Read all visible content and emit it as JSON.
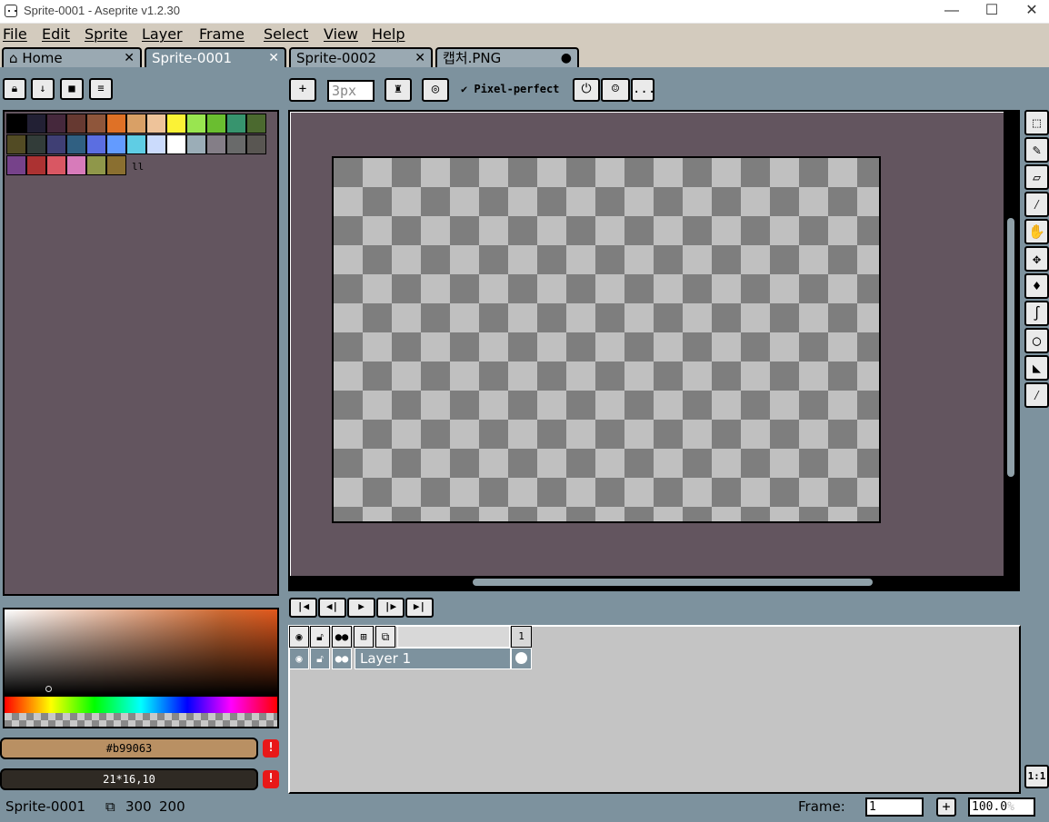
{
  "window": {
    "title": "Sprite-0001 - Aseprite v1.2.30",
    "controls": {
      "minimize": "—",
      "maximize": "☐",
      "close": "✕"
    }
  },
  "menu": [
    "File",
    "Edit",
    "Sprite",
    "Layer",
    "Frame",
    "Select",
    "View",
    "Help"
  ],
  "tabs": [
    {
      "label": "Home",
      "icon": "home-icon",
      "close": "✕"
    },
    {
      "label": "Sprite-0001",
      "close": "✕",
      "active": true
    },
    {
      "label": "Sprite-0002",
      "close": "✕"
    },
    {
      "label": "캡처.PNG",
      "modified": "●"
    }
  ],
  "palette_toolbar": {
    "icons": [
      "lock-icon",
      "sort-icon",
      "palette-icon",
      "menu-icon"
    ],
    "extra_mark": "ll"
  },
  "palette_colors": [
    "#000000",
    "#222034",
    "#45283c",
    "#663931",
    "#8f563b",
    "#df7126",
    "#d9a066",
    "#eec39a",
    "#fbf236",
    "#99e550",
    "#6abe30",
    "#37946e",
    "#4b692f",
    "#524b24",
    "#323c39",
    "#3f3f74",
    "#306082",
    "#5b6ee1",
    "#639bff",
    "#5fcde4",
    "#cbdbfc",
    "#ffffff",
    "#9badb7",
    "#847e87",
    "#696a6a",
    "#595652",
    "#76428a",
    "#ac3232",
    "#d95763",
    "#d77bba",
    "#8f974a",
    "#8a6f30"
  ],
  "toolbar": {
    "plus": "+",
    "brush_size": "3px",
    "pixel_perfect_label": "Pixel-perfect",
    "pixel_perfect_check": "✔",
    "more": "..."
  },
  "colors": {
    "foreground_hex": "#b99063",
    "background_value": "21*16,10",
    "foreground_color": "#b99063",
    "background_color": "#2f2a24",
    "warning": "!"
  },
  "tools": [
    {
      "name": "rectangular-marquee-icon",
      "glyph": "⬚"
    },
    {
      "name": "pencil-icon",
      "glyph": "✎"
    },
    {
      "name": "eraser-icon",
      "glyph": "▱"
    },
    {
      "name": "eyedropper-icon",
      "glyph": "⁄"
    },
    {
      "name": "hand-icon",
      "glyph": "✋"
    },
    {
      "name": "move-icon",
      "glyph": "✥"
    },
    {
      "name": "paint-bucket-icon",
      "glyph": "♦"
    },
    {
      "name": "curve-icon",
      "glyph": "∫"
    },
    {
      "name": "ellipse-icon",
      "glyph": "◯"
    },
    {
      "name": "contour-icon",
      "glyph": "◣"
    },
    {
      "name": "blur-icon",
      "glyph": "⁄"
    }
  ],
  "animation_controls": [
    "|◀",
    "◀|",
    "▶",
    "|▶",
    "▶|"
  ],
  "timeline": {
    "header_icons": [
      "eye-icon",
      "lock-icon",
      "continuous-icon",
      "group-icon",
      "onion-icon"
    ],
    "frame_number": "1",
    "layer_name": "Layer 1",
    "onion_zoom": "1:1"
  },
  "status": {
    "sprite_name": "Sprite-0001",
    "width": "300",
    "height": "200",
    "frame_label": "Frame:",
    "frame_value": "1",
    "add_frame": "+",
    "zoom": "100.0",
    "zoom_unit": "%"
  }
}
